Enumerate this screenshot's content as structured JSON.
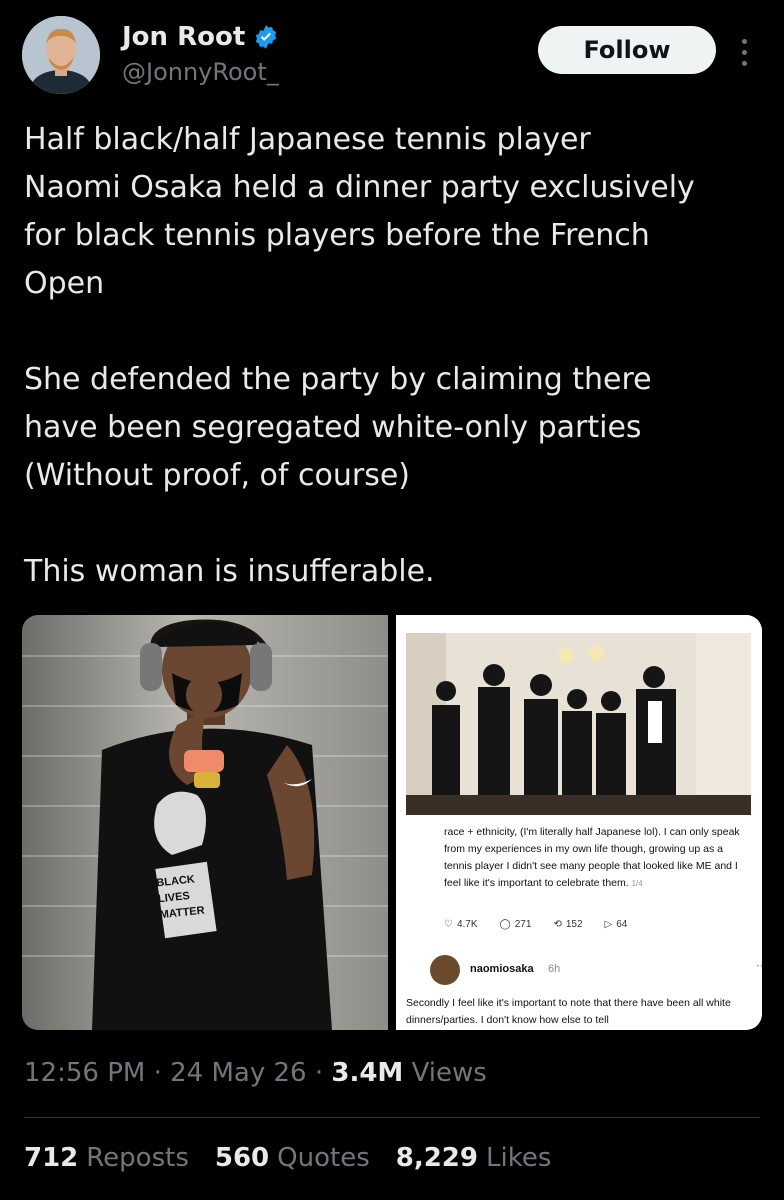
{
  "author": {
    "name": "Jon Root",
    "handle": "@JonnyRoot_",
    "verified_icon": "verified-badge-icon",
    "accent": "#1d9bf0"
  },
  "actions": {
    "follow_label": "Follow",
    "more_icon": "more-vertical-icon"
  },
  "tweet": {
    "text": "Half black/half Japanese tennis player\nNaomi Osaka held a dinner party exclusively\nfor black tennis players before the French\nOpen\n\nShe defended the party by claiming there\nhave been segregated white-only parties\n(Without proof, of course)\n\nThis woman is insufferable."
  },
  "media": {
    "left_shirt_text_1": "BLACK",
    "left_shirt_text_2": "LIVES",
    "left_shirt_text_3": "MATTER",
    "screenshot": {
      "post_text": "race + ethnicity, (I'm literally half Japanese lol). I can only speak from my experiences in my own life though, growing up as a tennis player I didn't see many people that looked like ME and I feel like it's important to celebrate them.",
      "thread_marker": "1/4",
      "likes": "4.7K",
      "replies": "271",
      "reposts": "152",
      "shares": "64",
      "reply_author": "naomiosaka",
      "reply_time": "6h",
      "reply_text": "Secondly I feel like it's important to note that there have been all white dinners/parties. I don't know how else to tell"
    }
  },
  "meta": {
    "time": "12:56 PM",
    "date": "24 May 26",
    "views_count": "3.4M",
    "views_label": "Views",
    "sep": "·"
  },
  "counts": {
    "reposts_count": "712",
    "reposts_label": "Reposts",
    "quotes_count": "560",
    "quotes_label": "Quotes",
    "likes_count": "8,229",
    "likes_label": "Likes"
  }
}
